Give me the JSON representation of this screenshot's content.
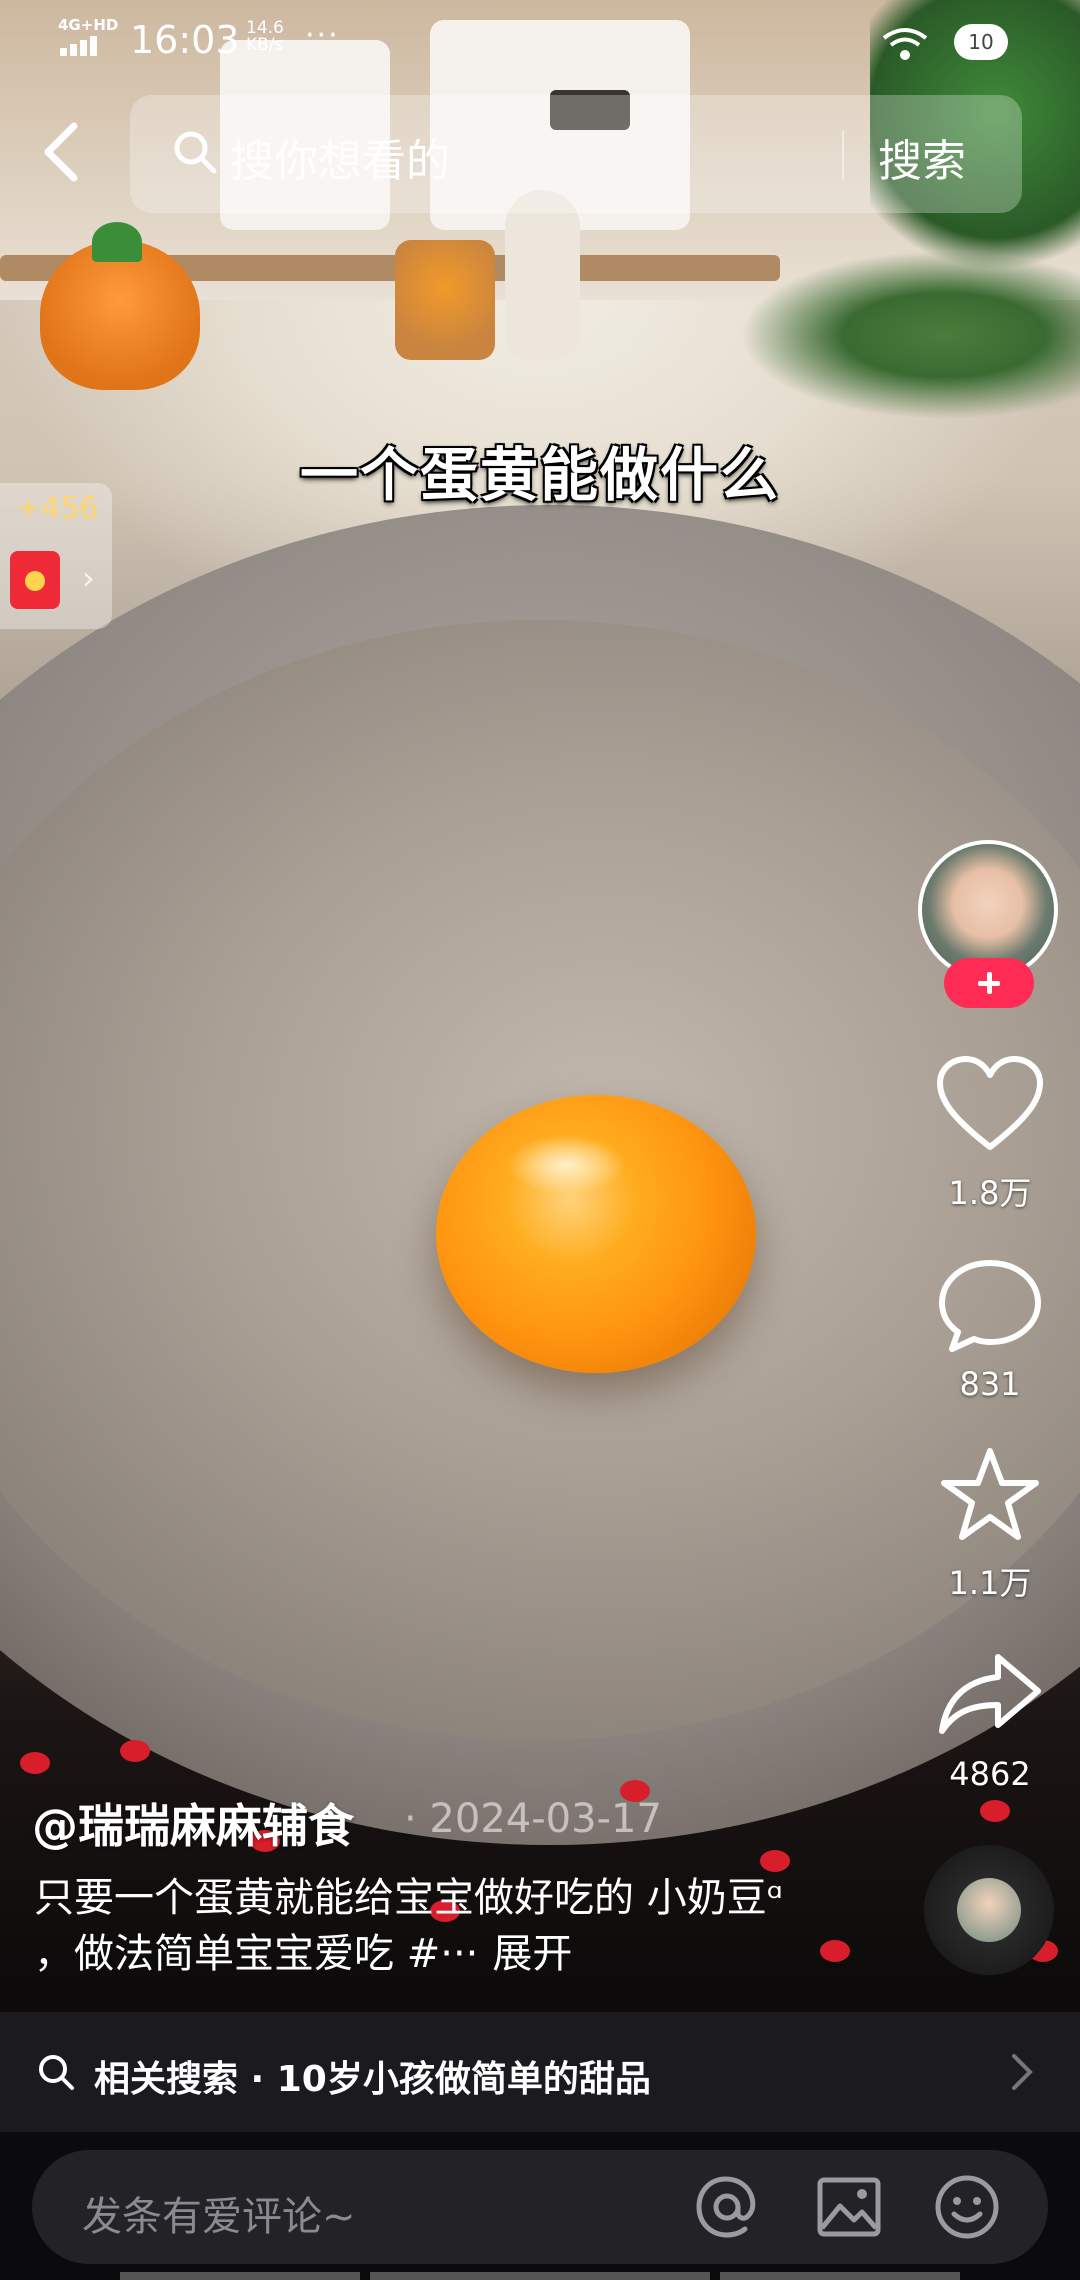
{
  "status_bar": {
    "network": "4G+HD",
    "time": "16:03",
    "speed_value": "14.6",
    "speed_unit": "KB/s",
    "more": "···",
    "battery": "10"
  },
  "header": {
    "search_placeholder": "搜你想看的",
    "search_button": "搜索"
  },
  "video": {
    "title_overlay": "一个蛋黄能做什么"
  },
  "reward": {
    "points": "+456",
    "arrow": "›"
  },
  "actions": {
    "likes": "1.8万",
    "comments": "831",
    "favorites": "1.1万",
    "shares": "4862"
  },
  "caption": {
    "author": "@瑞瑞麻麻辅食",
    "date": "· 2024-03-17",
    "description": "只要一个蛋黄就能给宝宝做好吃的 小奶豆ᵅ ，做法简单宝宝爱吃 #···",
    "expand": "展开"
  },
  "related_search": {
    "label": "相关搜索 · 10岁小孩做简单的甜品"
  },
  "comment_bar": {
    "placeholder": "发条有爱评论~"
  },
  "colors": {
    "follow": "#fe2c55",
    "reward_points": "#ffd66b"
  }
}
